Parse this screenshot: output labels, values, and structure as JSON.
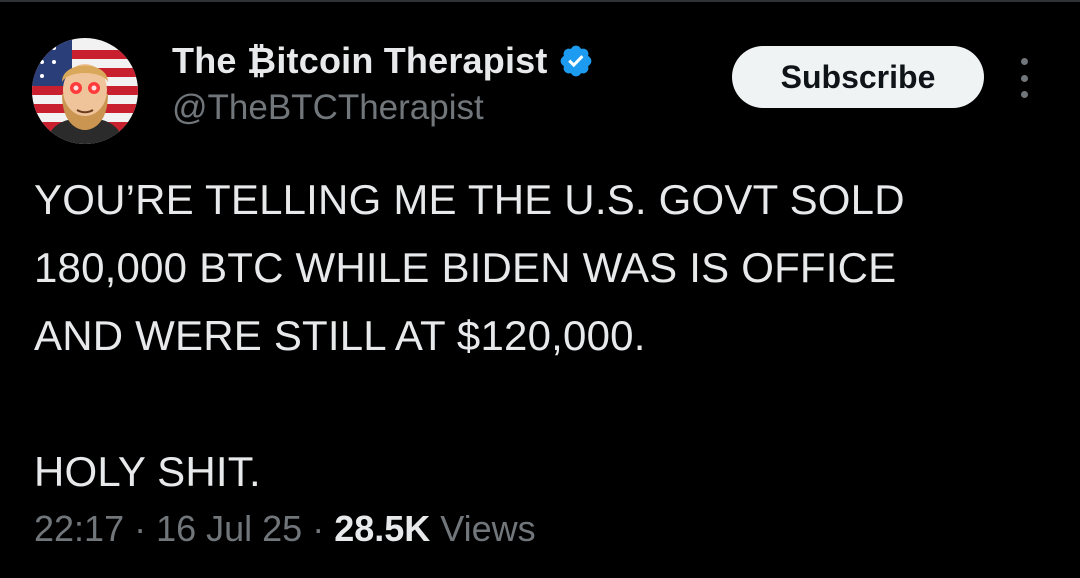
{
  "author": {
    "display_name": "The ₿itcoin Therapist",
    "handle": "@TheBTCTherapist",
    "verified": true,
    "verified_color": "#1d9bf0"
  },
  "actions": {
    "subscribe_label": "Subscribe",
    "more_icon": "more-vertical-icon"
  },
  "tweet": {
    "lines": [
      "YOU’RE TELLING ME THE U.S. GOVT SOLD",
      "180,000 BTC WHILE BIDEN WAS IS OFFICE",
      "AND WERE STILL AT $120,000.",
      "HOLY SHIT."
    ]
  },
  "meta": {
    "time": "22:17",
    "separator": "·",
    "date": "16 Jul 25",
    "views_count": "28.5K",
    "views_label": "Views"
  },
  "colors": {
    "background": "#000000",
    "text": "#e7e9ea",
    "muted": "#71767b",
    "button_bg": "#eff3f4",
    "button_text": "#0f1419"
  }
}
